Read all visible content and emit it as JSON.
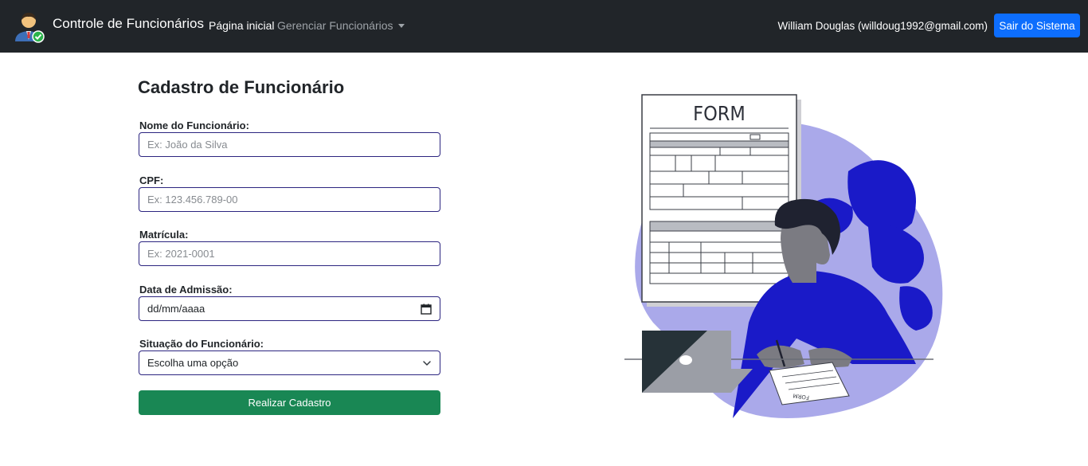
{
  "navbar": {
    "brand_title": "Controle de Funcionários",
    "home_label": "Página inicial",
    "manage_label": "Gerenciar Funcionários",
    "user_info": "William Douglas (willdoug1992@gmail.com)",
    "logout_label": "Sair do Sistema"
  },
  "form": {
    "title": "Cadastro de Funcionário",
    "name_label": "Nome do Funcionário:",
    "name_placeholder": "Ex: João da Silva",
    "cpf_label": "CPF:",
    "cpf_placeholder": "Ex: 123.456.789-00",
    "registration_label": "Matrícula:",
    "registration_placeholder": "Ex: 2021-0001",
    "admission_label": "Data de Admissão:",
    "admission_value": "dd/mm/aaaa",
    "status_label": "Situação do Funcionário:",
    "status_value": "Escolha uma opção",
    "submit_label": "Realizar Cadastro"
  },
  "illustration": {
    "form_heading": "FORM",
    "paper_text": "FORM"
  },
  "icons": {
    "logo": "employee-check-icon",
    "dropdown": "caret-down-icon",
    "calendar": "calendar-icon",
    "select": "chevron-down-icon"
  },
  "colors": {
    "navbar_bg": "#212529",
    "primary": "#0d6efd",
    "success": "#198754",
    "input_border": "#2c2580",
    "illustration_blue": "#1a1ac8",
    "illustration_lavender": "#aaa9ea"
  }
}
